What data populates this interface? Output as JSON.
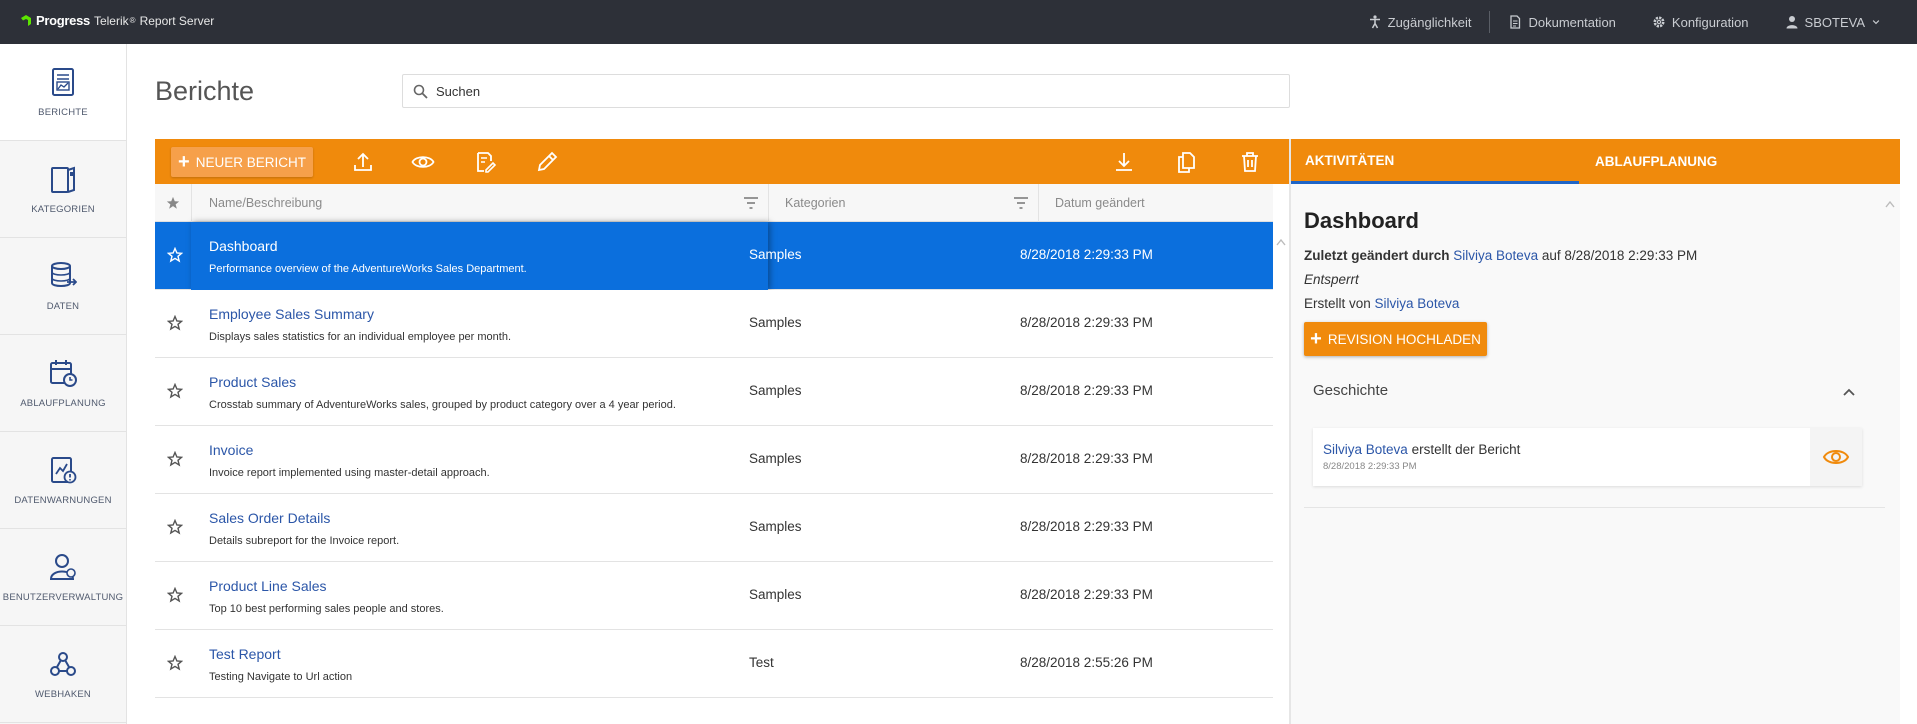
{
  "app": {
    "brand_name": "Progress",
    "product_name": "Telerik",
    "product_suffix": "Report Server"
  },
  "topnav": {
    "accessibility": "Zugänglichkeit",
    "documentation": "Dokumentation",
    "configuration": "Konfiguration",
    "user": "SBOTEVA"
  },
  "sidebar": {
    "items": [
      {
        "label": "BERICHTE",
        "icon": "report-icon"
      },
      {
        "label": "KATEGORIEN",
        "icon": "categories-icon"
      },
      {
        "label": "DATEN",
        "icon": "database-icon"
      },
      {
        "label": "ABLAUFPLANUNG",
        "icon": "schedule-icon"
      },
      {
        "label": "DATENWARNUNGEN",
        "icon": "data-alert-icon"
      },
      {
        "label": "BENUTZERVERWALTUNG",
        "icon": "users-icon"
      },
      {
        "label": "WEBHAKEN",
        "icon": "webhook-icon"
      }
    ]
  },
  "header": {
    "title": "Berichte",
    "search_placeholder": "Suchen"
  },
  "toolbar": {
    "new_report": "NEUER BERICHT"
  },
  "grid": {
    "columns": {
      "name": "Name/Beschreibung",
      "categories": "Kategorien",
      "date": "Datum geändert"
    },
    "rows": [
      {
        "name": "Dashboard",
        "desc": "Performance overview of the AdventureWorks Sales Department.",
        "cat": "Samples",
        "date": "8/28/2018 2:29:33 PM",
        "selected": true
      },
      {
        "name": "Employee Sales Summary",
        "desc": "Displays sales statistics for an individual employee per month.",
        "cat": "Samples",
        "date": "8/28/2018 2:29:33 PM"
      },
      {
        "name": "Product Sales",
        "desc": "Crosstab summary of AdventureWorks sales, grouped by product category over a 4 year period.",
        "cat": "Samples",
        "date": "8/28/2018 2:29:33 PM"
      },
      {
        "name": "Invoice",
        "desc": "Invoice report implemented using master-detail approach.",
        "cat": "Samples",
        "date": "8/28/2018 2:29:33 PM"
      },
      {
        "name": "Sales Order Details",
        "desc": "Details subreport for the Invoice report.",
        "cat": "Samples",
        "date": "8/28/2018 2:29:33 PM"
      },
      {
        "name": "Product Line Sales",
        "desc": "Top 10 best performing sales people and stores.",
        "cat": "Samples",
        "date": "8/28/2018 2:29:33 PM"
      },
      {
        "name": "Test Report",
        "desc": "Testing Navigate to Url action",
        "cat": "Test",
        "date": "8/28/2018 2:55:26 PM"
      }
    ]
  },
  "panel": {
    "tabs": {
      "activities": "AKTIVITÄTEN",
      "scheduling": "ABLAUFPLANUNG"
    },
    "title": "Dashboard",
    "modified_prefix": "Zuletzt geändert durch",
    "modified_user": "Silviya Boteva",
    "modified_suffix": "auf 8/28/2018 2:29:33 PM",
    "lock_status": "Entsperrt",
    "created_prefix": "Erstellt von",
    "created_user": "Silviya Boteva",
    "upload_revision": "REVISION HOCHLADEN",
    "history_title": "Geschichte",
    "history": {
      "user": "Silviya Boteva",
      "action": "erstellt der Bericht",
      "timestamp": "8/28/2018 2:29:33 PM"
    }
  },
  "colors": {
    "accent_orange": "#f08a0c",
    "selection_blue": "#0b6fdd",
    "link_blue": "#2b56a8",
    "topbar": "#2d3038"
  }
}
